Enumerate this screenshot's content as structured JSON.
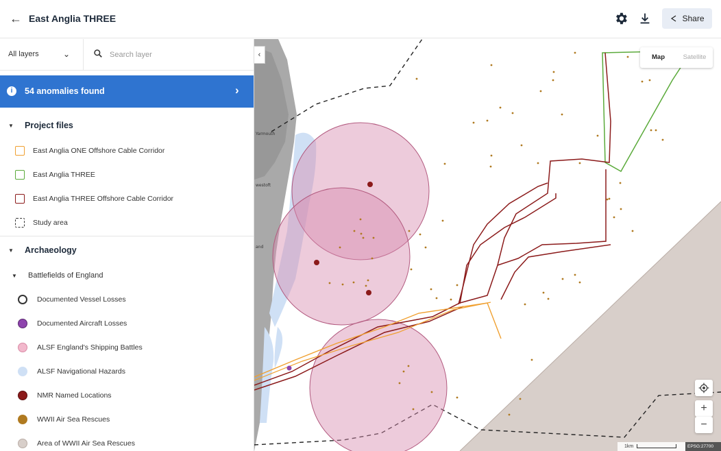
{
  "header": {
    "back_icon": "arrow-left-icon",
    "title": "East Anglia THREE",
    "settings_icon": "gear-icon",
    "download_icon": "download-icon",
    "share_label": "Share",
    "share_icon": "share-icon"
  },
  "sidebar": {
    "layer_filter": "All layers",
    "search_placeholder": "Search layer",
    "anomaly_banner": "54 anomalies found",
    "project_files": {
      "title": "Project files",
      "items": [
        {
          "label": "East Anglia ONE Offshore Cable Corridor",
          "color": "#f0a030",
          "symbol": "square"
        },
        {
          "label": "East Anglia THREE",
          "color": "#5aaa3a",
          "symbol": "square"
        },
        {
          "label": "East Anglia THREE Offshore Cable Corridor",
          "color": "#8b1a1a",
          "symbol": "square"
        },
        {
          "label": "Study area",
          "color": "#333333",
          "symbol": "dashed-square"
        }
      ]
    },
    "archaeology": {
      "title": "Archaeology",
      "subgroup": "Battlefields of England",
      "items": [
        {
          "label": "Documented Vessel Losses",
          "color": "#333333",
          "symbol": "hollow-circle"
        },
        {
          "label": "Documented Aircraft Losses",
          "color": "#8e44ad",
          "symbol": "circle"
        },
        {
          "label": "ALSF England's Shipping Battles",
          "color": "#f2b8cc",
          "symbol": "circle"
        },
        {
          "label": "ALSF Navigational Hazards",
          "color": "#cfe0f5",
          "symbol": "circle"
        },
        {
          "label": "NMR Named Locations",
          "color": "#8b1a1a",
          "symbol": "circle"
        },
        {
          "label": "WWII Air Sea Rescues",
          "color": "#b07a20",
          "symbol": "circle"
        },
        {
          "label": "Area of WWII Air Sea Rescues",
          "color": "#d8cfca",
          "symbol": "circle"
        }
      ]
    }
  },
  "map": {
    "toggle_map": "Map",
    "toggle_satellite": "Satellite",
    "place_labels": [
      "Yarmouth",
      "westoft",
      "and"
    ],
    "scale_label": "1km",
    "epsg_label": "EPSG:27700",
    "zoom_in": "+",
    "zoom_out": "−",
    "locate_icon": "locate-icon",
    "collapse_icon": "chevron-left-icon"
  }
}
